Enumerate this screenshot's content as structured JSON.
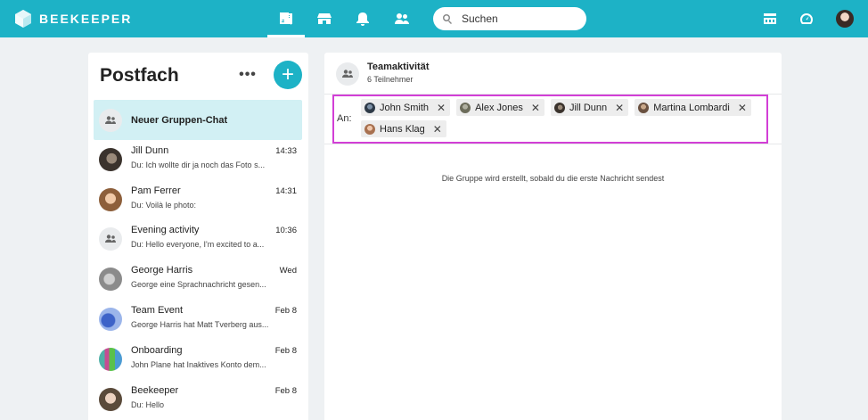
{
  "app": {
    "brand": "BEEKEEPER",
    "accent_color": "#1db2c6",
    "highlight_color": "#d23fd6"
  },
  "topbar": {
    "nav": [
      {
        "icon": "news-feed-icon"
      },
      {
        "icon": "chat-bubble-icon",
        "active": true
      },
      {
        "icon": "store-icon"
      },
      {
        "icon": "bell-icon"
      },
      {
        "icon": "people-icon"
      }
    ],
    "search": {
      "placeholder": "Suchen"
    },
    "right_icons": [
      "streams-icon",
      "dashboard-gauge-icon",
      "profile-avatar"
    ]
  },
  "inbox": {
    "title": "Postfach",
    "more_label": "•••",
    "new_button_label": "+",
    "new_group_chat_label": "Neuer Gruppen-Chat",
    "conversations": [
      {
        "name": "Jill Dunn",
        "time": "14:33",
        "preview": "Du: Ich wollte dir ja noch das Foto s...",
        "avatar": "photo"
      },
      {
        "name": "Pam Ferrer",
        "time": "14:31",
        "preview": "Du: Voilà le photo:",
        "avatar": "photo"
      },
      {
        "name": "Evening activity",
        "time": "10:36",
        "preview": "Du: Hello everyone, I'm excited to a...",
        "avatar": "group-icon"
      },
      {
        "name": "George Harris",
        "time": "Wed",
        "preview": "George eine Sprachnachricht gesen...",
        "avatar": "photo"
      },
      {
        "name": "Team Event",
        "time": "Feb 8",
        "preview": "George Harris hat Matt Tverberg aus...",
        "avatar": "photo"
      },
      {
        "name": "Onboarding",
        "time": "Feb 8",
        "preview": "John Plane hat Inaktives Konto dem...",
        "avatar": "photo"
      },
      {
        "name": "Beekeeper",
        "time": "Feb 8",
        "preview": "Du: Hello",
        "avatar": "photo"
      }
    ]
  },
  "chat": {
    "title": "Teamaktivität",
    "subtitle": "6 Teilnehmer",
    "to_label": "An:",
    "recipients": [
      {
        "name": "John Smith",
        "remove": "✕"
      },
      {
        "name": "Alex Jones",
        "remove": "✕"
      },
      {
        "name": "Jill Dunn",
        "remove": "✕"
      },
      {
        "name": "Martina Lombardi",
        "remove": "✕"
      },
      {
        "name": "Hans Klag",
        "remove": "✕"
      }
    ],
    "info_text": "Die Gruppe wird erstellt, sobald du die erste Nachricht sendest"
  }
}
